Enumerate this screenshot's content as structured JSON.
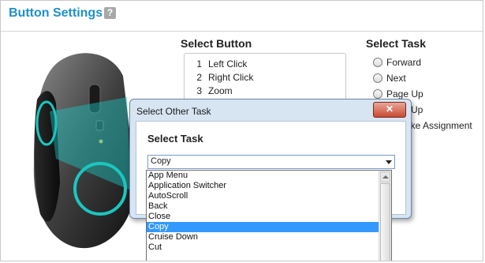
{
  "header": {
    "title": "Button Settings",
    "help": "?"
  },
  "select_button": {
    "heading": "Select Button",
    "items": [
      {
        "num": "1",
        "label": "Left Click"
      },
      {
        "num": "2",
        "label": "Right Click"
      },
      {
        "num": "3",
        "label": "Zoom"
      }
    ]
  },
  "select_task": {
    "heading": "Select Task",
    "options": [
      "Forward",
      "Next",
      "Page Up",
      "Up",
      "oke Assignment"
    ]
  },
  "dialog": {
    "title": "Select Other Task",
    "close": "✕",
    "heading": "Select Task",
    "selected": "Copy",
    "options": [
      "App Menu",
      "Application Switcher",
      "AutoScroll",
      "Back",
      "Close",
      "Copy",
      "Cruise Down",
      "Cut"
    ],
    "selected_index": 5
  },
  "colors": {
    "accent": "#1e90c8",
    "teal": "#1bc6c0",
    "selection": "#3399ff"
  }
}
